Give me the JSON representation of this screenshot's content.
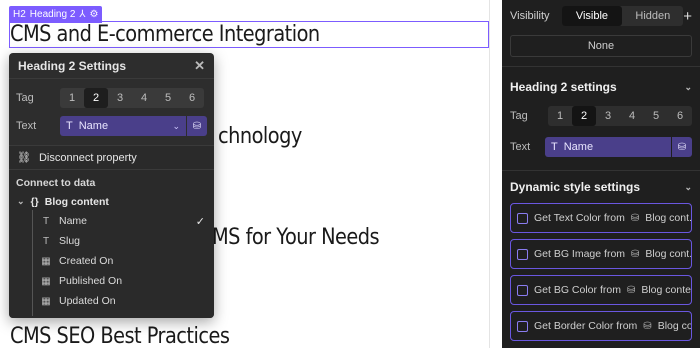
{
  "canvas": {
    "heading_tag": {
      "tag": "H2",
      "label": "Heading 2"
    },
    "headings": [
      "CMS and E-commerce Integration",
      "chnology",
      "MS for Your Needs",
      "CMS SEO Best Practices"
    ]
  },
  "popover": {
    "title": "Heading 2 Settings",
    "tag_label": "Tag",
    "tag_options": [
      "1",
      "2",
      "3",
      "4",
      "5",
      "6"
    ],
    "tag_selected": "2",
    "text_label": "Text",
    "text_value": "Name",
    "dropdown": {
      "disconnect": "Disconnect property",
      "section": "Connect to data",
      "group": "Blog content",
      "items": [
        {
          "label": "Name",
          "icon": "text-icon",
          "checked": true
        },
        {
          "label": "Slug",
          "icon": "text-icon",
          "checked": false
        },
        {
          "label": "Created On",
          "icon": "calendar-icon",
          "checked": false
        },
        {
          "label": "Published On",
          "icon": "calendar-icon",
          "checked": false
        },
        {
          "label": "Updated On",
          "icon": "calendar-icon",
          "checked": false
        }
      ]
    }
  },
  "panel": {
    "visibility_label": "Visibility",
    "visibility_options": [
      "Visible",
      "Hidden"
    ],
    "visibility_selected": "Visible",
    "none_label": "None",
    "heading_section": "Heading 2 settings",
    "tag_label": "Tag",
    "tag_options": [
      "1",
      "2",
      "3",
      "4",
      "5",
      "6"
    ],
    "text_label": "Text",
    "text_value": "Name",
    "dynamic_section": "Dynamic style settings",
    "dynamic_items": [
      {
        "prefix": "Get Text Color from",
        "source": "Blog cont..."
      },
      {
        "prefix": "Get BG Image from",
        "source": "Blog cont..."
      },
      {
        "prefix": "Get BG Color from",
        "source": "Blog content"
      },
      {
        "prefix": "Get Border Color from",
        "source": "Blog co..."
      }
    ]
  },
  "colors": {
    "accent": "#7c5cff",
    "bound_field": "#4a3f8a",
    "panel_bg": "#1f1f1f",
    "popover_bg": "#2d2d2d"
  }
}
